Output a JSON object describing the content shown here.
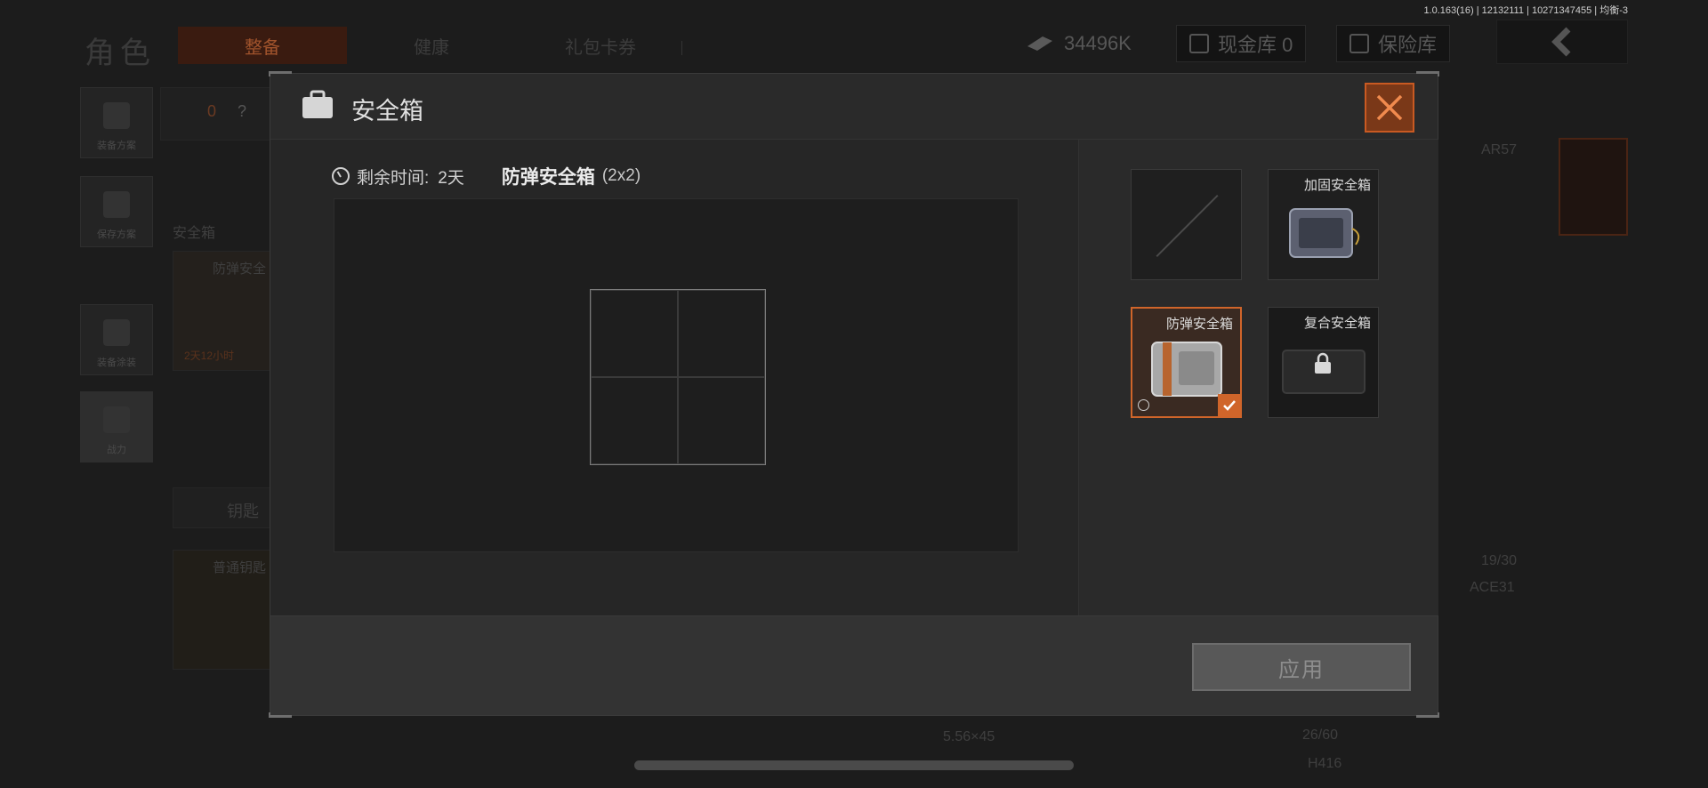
{
  "version": "1.0.163(16) | 12132111 | 10271347455 | 均衡-3",
  "topbar": {
    "role_title": "角色",
    "tabs": [
      {
        "label": "整备",
        "active": true
      },
      {
        "label": "健康",
        "active": false
      },
      {
        "label": "礼包卡券",
        "active": false
      }
    ],
    "currency": "34496K",
    "cash_vault": "现金库 0",
    "insurance": "保险库"
  },
  "left_panel": {
    "buttons": [
      "装备方案",
      "保存方案",
      "装备涂装",
      "战力"
    ],
    "armor_count": "0",
    "help": "?",
    "safebox_label": "安全箱",
    "safebox_item": "防弹安全",
    "safebox_timer": "2天12小时",
    "key_label": "钥匙",
    "key_item": "普通钥匙"
  },
  "right_bg": {
    "weapon_top": "AR57",
    "ammo_top": "19/30",
    "weapon_mid": "ACE31",
    "ammo_caliber": "5.56×45",
    "ammo_bottom": "26/60",
    "weapon_bottom": "H416"
  },
  "modal": {
    "title": "安全箱",
    "remaining_label": "剩余时间:",
    "remaining_value": "2天",
    "case_name": "防弹安全箱",
    "case_size": "(2x2)",
    "grid": {
      "cols": 2,
      "rows": 2
    },
    "slots": [
      {
        "name": "",
        "state": "empty"
      },
      {
        "name": "加固安全箱",
        "state": "available"
      },
      {
        "name": "防弹安全箱",
        "state": "selected",
        "timed": true
      },
      {
        "name": "复合安全箱",
        "state": "locked"
      }
    ],
    "apply_label": "应用"
  },
  "colors": {
    "accent": "#d0652a",
    "close_bg": "#7a3818",
    "modal_bg": "#262626"
  }
}
